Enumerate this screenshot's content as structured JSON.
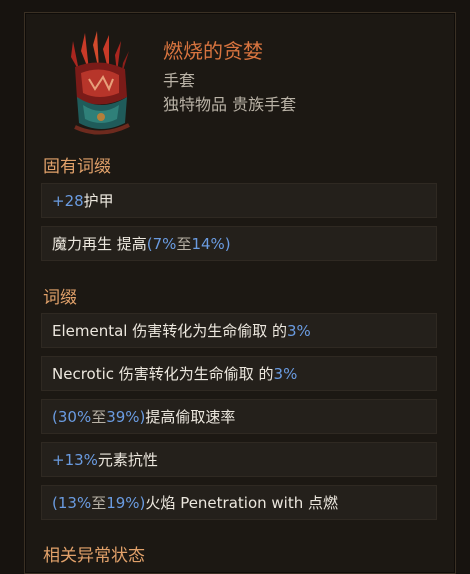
{
  "item": {
    "name": "燃烧的贪婪",
    "type": "手套",
    "subtitle": "独特物品 贵族手套",
    "icon": "burning-gauntlet-icon"
  },
  "sections": {
    "implicit": {
      "title": "固有词缀",
      "rows": [
        {
          "v1": "+28",
          "t1": " 护甲"
        },
        {
          "t1": "魔力再生 提高 ",
          "v1": "(7%",
          "t2": " 至 ",
          "v2": "14%)"
        }
      ]
    },
    "affixes": {
      "title": "词缀",
      "rows": [
        {
          "t1": "Elemental 伤害转化为生命偷取 的 ",
          "v1": "3%"
        },
        {
          "t1": "Necrotic 伤害转化为生命偷取 的 ",
          "v1": "3%"
        },
        {
          "v1": "(30%",
          "t1": " 至 ",
          "v2": "39%)",
          "t2": " 提高偷取速率"
        },
        {
          "v1": "+13%",
          "t1": " 元素抗性"
        },
        {
          "v1": "(13%",
          "t1": " 至 ",
          "v2": "19%)",
          "t2": " 火焰 Penetration with 点燃"
        }
      ]
    },
    "related": {
      "title": "相关异常状态"
    }
  },
  "colors": {
    "title": "#d8743f",
    "section": "#e1a16a",
    "value": "#6a9be0"
  }
}
